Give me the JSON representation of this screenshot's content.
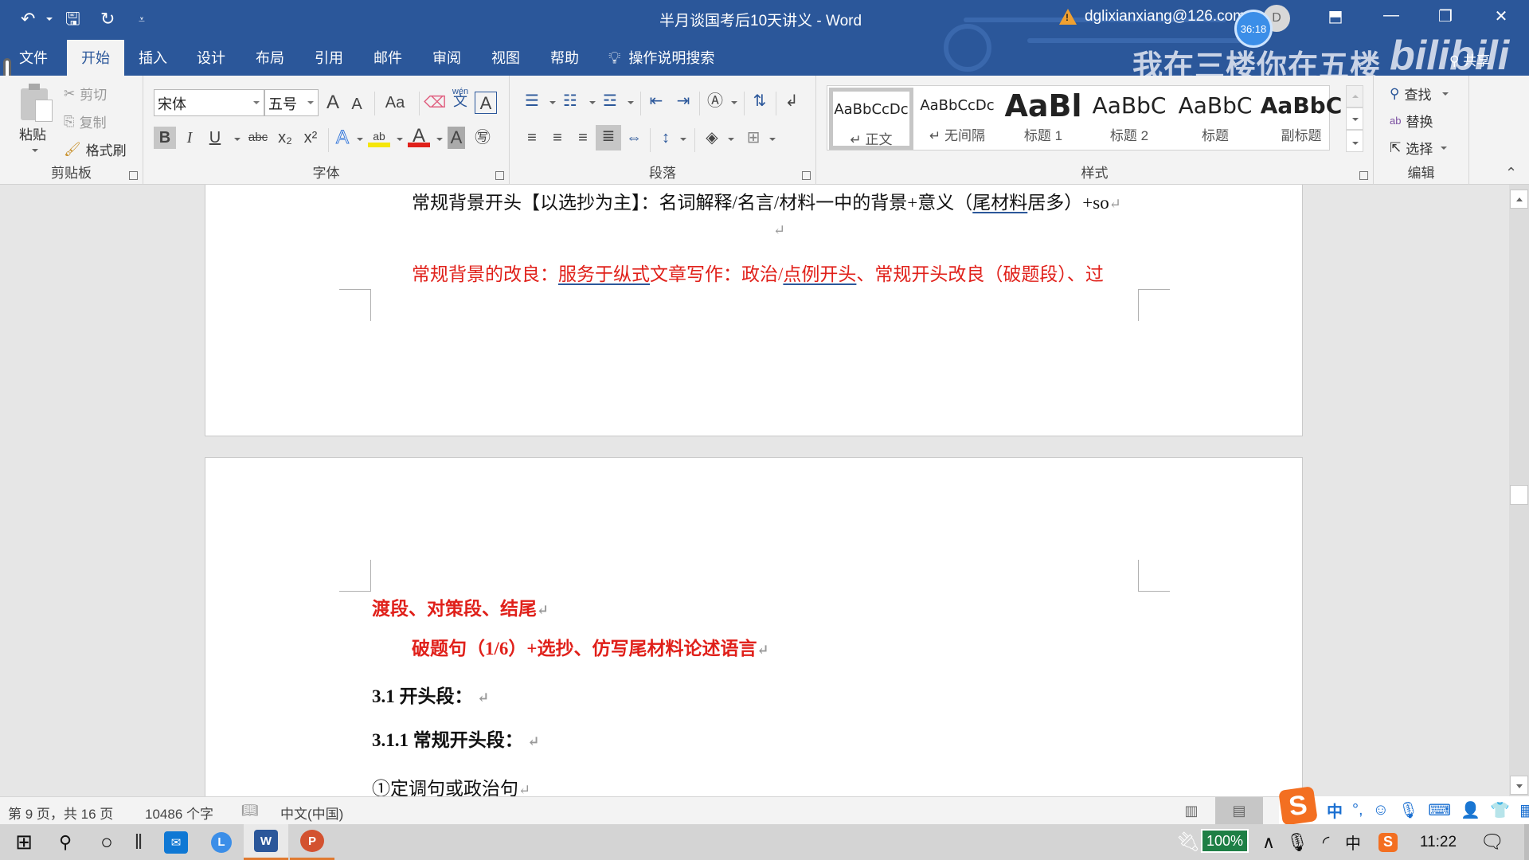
{
  "window": {
    "title": "半月谈国考后10天讲义  -  Word",
    "account": "dglixianxiang@126.com",
    "avatar_initial": "D",
    "timer": "36:18",
    "watermark": "我在三楼你在五楼",
    "watermark_logo": "bilibili",
    "share_label": "共享",
    "icons": {
      "undo": "↶",
      "save": "🖫",
      "redo": "↻",
      "customize": "⩡",
      "ribbon_display": "⬒",
      "minimize": "—",
      "restore": "❐",
      "close": "✕"
    }
  },
  "tabs": [
    {
      "label": "文件",
      "active": false
    },
    {
      "label": "开始",
      "active": true
    },
    {
      "label": "插入",
      "active": false
    },
    {
      "label": "设计",
      "active": false
    },
    {
      "label": "布局",
      "active": false
    },
    {
      "label": "引用",
      "active": false
    },
    {
      "label": "邮件",
      "active": false
    },
    {
      "label": "审阅",
      "active": false
    },
    {
      "label": "视图",
      "active": false
    },
    {
      "label": "帮助",
      "active": false
    }
  ],
  "tell_me": "操作说明搜索",
  "ribbon": {
    "clipboard": {
      "label": "剪贴板",
      "paste": "粘贴",
      "cut": "剪切",
      "copy": "复制",
      "format_painter": "格式刷"
    },
    "font": {
      "label": "字体",
      "font_name": "宋体",
      "font_size": "五号",
      "grow": "A",
      "shrink": "A",
      "change_case": "Aa",
      "phonetic": "wén",
      "phonetic_char": "文",
      "border_char": "A",
      "bold": "B",
      "italic": "I",
      "underline": "U",
      "strike": "abc",
      "subscript": "x₂",
      "superscript": "x²",
      "text_effects": "A",
      "highlight": "ab",
      "font_color": "A",
      "shading": "A",
      "enclose": "㊢",
      "highlight_color": "#f5e60a",
      "font_color_value": "#e0201a"
    },
    "paragraph": {
      "label": "段落"
    },
    "styles": {
      "label": "样式",
      "items": [
        {
          "preview": "AaBbCcDc",
          "name": "↵ 正文",
          "selected": true
        },
        {
          "preview": "AaBbCcDc",
          "name": "↵ 无间隔",
          "selected": false
        },
        {
          "preview": "AaBl",
          "name": "标题 1",
          "selected": false
        },
        {
          "preview": "AaBbC",
          "name": "标题 2",
          "selected": false
        },
        {
          "preview": "AaBbC",
          "name": "标题",
          "selected": false
        },
        {
          "preview": "AaBbC",
          "name": "副标题",
          "selected": false
        }
      ]
    },
    "editing": {
      "label": "编辑",
      "find": "查找",
      "replace": "替换",
      "select": "选择"
    }
  },
  "document": {
    "page1": {
      "line1": {
        "a": "常规背景开头【以选抄为主】：名词解释/名言/材料一中的背景+意义（",
        "u": "尾材料",
        "b": "居多）+so"
      },
      "line2": "",
      "line3": {
        "a": "常规背景的改良：",
        "u1": "服务于纵式",
        "b": "文章写作：政治/",
        "u2": "点例开头",
        "c": "、常规开头改良（破题段）、过"
      }
    },
    "page2": {
      "line1": "渡段、对策段、结尾",
      "line2": "破题句（1/6）+选抄、仿写尾材料论述语言",
      "line3": "3.1  开头段：",
      "line4": "3.1.1  常规开头段：",
      "line5": "①定调句或政治句"
    },
    "paragraph_mark": "↵"
  },
  "statusbar": {
    "page": "第 9 页，共 16 页",
    "words": "10486 个字",
    "language": "中文(中国)"
  },
  "ime": {
    "logo": "S",
    "items": [
      "中",
      "°,",
      "☺",
      "🎙",
      "⌨",
      "👤",
      "👕",
      "▦"
    ]
  },
  "taskbar": {
    "battery": "100%",
    "clock": "11:22",
    "ime_lang": "中",
    "apps": [
      {
        "name": "mail",
        "glyph": "✉",
        "color": "#0f78d4"
      },
      {
        "name": "lenovo",
        "glyph": "L",
        "color": "#3b8ee8"
      },
      {
        "name": "word",
        "glyph": "W",
        "color": "#2b579a"
      },
      {
        "name": "powerpoint",
        "glyph": "P",
        "color": "#d35230"
      }
    ]
  }
}
